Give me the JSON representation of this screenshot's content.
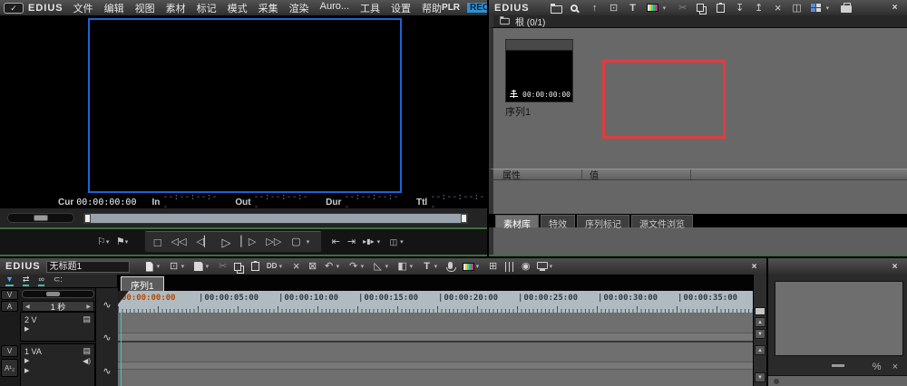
{
  "colors": {
    "accent_blue": "#1f62d6",
    "rec_blue": "#2e8fd6",
    "selection_red": "#e23c3e",
    "playhead_teal": "#38caca",
    "ruler_current_orange": "#b54a00"
  },
  "player": {
    "app_name": "EDIUS",
    "menus": [
      "文件",
      "编辑",
      "视图",
      "素材",
      "标记",
      "模式",
      "采集",
      "渲染",
      "Auro...",
      "工具",
      "设置",
      "帮助"
    ],
    "plr": "PLR",
    "rec": "REC",
    "minimize": "_",
    "close": "×",
    "timecodes": [
      {
        "label": "Cur",
        "value": "00:00:00:00"
      },
      {
        "label": "In",
        "value": "--:--:--:--"
      },
      {
        "label": "Out",
        "value": "--:--:--:--"
      },
      {
        "label": "Dur",
        "value": "--:--:--:--"
      },
      {
        "label": "Ttl",
        "value": "--:--:--:--"
      }
    ],
    "transport": {
      "marker_in": "⚐",
      "marker_out": "⚑",
      "dropdown": "▾",
      "stop": "□",
      "rewind": "◁◁",
      "prev_frame": "◁▏",
      "play": "▷",
      "play_fwd": "▏▷",
      "fast_forward": "▷▷",
      "display": "▢",
      "goto_in": "⇤",
      "goto_out": "⇥",
      "play_around": "▸▮▸",
      "export": "◫"
    }
  },
  "bin": {
    "app_name": "EDIUS",
    "close": "×",
    "toolbar": {
      "up": "↑",
      "import": "⊡",
      "title": "T",
      "cut": "✂",
      "pin_down": "↧",
      "pin_up": "↥",
      "delete": "×",
      "properties": "◫",
      "dropdown": "▾"
    },
    "folder_label": "根 (0/1)",
    "clip": {
      "name": "序列1",
      "timecode": "00:00:00:00"
    },
    "props": {
      "property": "属性",
      "value": "值"
    },
    "tabs": [
      "素材库",
      "特效",
      "序列标记",
      "源文件浏览"
    ]
  },
  "timeline": {
    "app_name": "EDIUS",
    "close": "×",
    "sequence_field": "无标题1",
    "sequence_tab": "序列1",
    "toolbar": {
      "dropdown": "▾",
      "cut": "✂",
      "replace": "DD",
      "ripple_delete": "×",
      "delete": "⊠",
      "undo": "↶",
      "redo": "↷",
      "razor": "◺",
      "transition": "◧",
      "title": "T",
      "multicam": "⊞",
      "wheel": "◉"
    },
    "modes": {
      "insert": "▼",
      "ripple": "⇄",
      "group": "∞",
      "snap": "⊂:"
    },
    "patch": {
      "video": "V",
      "audio": "A",
      "video2": "V",
      "audio12": "A¹₂",
      "route": "∿"
    },
    "scale": {
      "prev": "◀",
      "label": "1 秒",
      "next": "▶"
    },
    "tracks": [
      {
        "label": "2 V",
        "film": "▤",
        "expand": "▶"
      },
      {
        "label": "1 VA",
        "film": "▤",
        "expand": "▶",
        "speaker": "◀)",
        "expand2": "▶"
      }
    ],
    "ruler_ticks": [
      "00:00:00:00",
      "00:00:05:00",
      "00:00:10:00",
      "00:00:15:00",
      "00:00:20:00",
      "00:00:25:00",
      "00:00:30:00",
      "00:00:35:00"
    ],
    "scroll": {
      "up": "▲",
      "down": "▼"
    }
  },
  "preview_panel": {
    "close": "×",
    "settings": "%",
    "delete": "×"
  }
}
